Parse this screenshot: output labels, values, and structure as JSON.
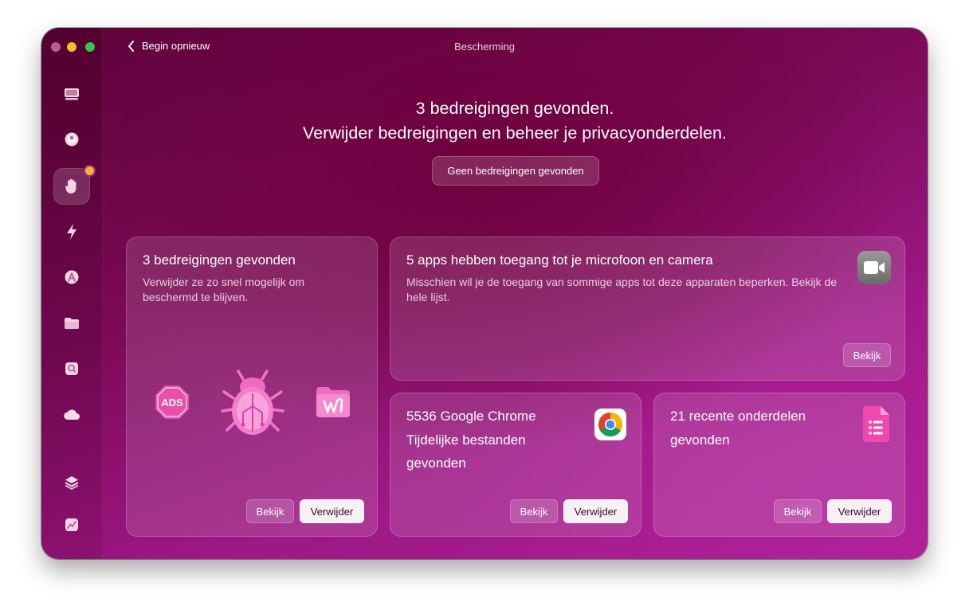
{
  "window": {
    "title": "Bescherming",
    "back_label": "Begin opnieuw"
  },
  "sidebar": {
    "items": [
      {
        "name": "smart-scan",
        "icon": "monitor-icon"
      },
      {
        "name": "cleanup",
        "icon": "disc-icon"
      },
      {
        "name": "protection",
        "icon": "hand-icon",
        "active": true,
        "badge": true
      },
      {
        "name": "performance",
        "icon": "lightning-icon"
      },
      {
        "name": "applications",
        "icon": "apps-icon"
      },
      {
        "name": "my-clutter",
        "icon": "folder-icon"
      },
      {
        "name": "space-lens",
        "icon": "magnifier-icon"
      },
      {
        "name": "cloud-cleanup",
        "icon": "cloud-icon"
      },
      {
        "name": "assistant",
        "icon": "layers-icon"
      },
      {
        "name": "updates",
        "icon": "chart-icon"
      }
    ]
  },
  "main": {
    "headline_line1": "3 bedreigingen gevonden.",
    "headline_line2": "Verwijder bedreigingen en beheer je privacyonderdelen.",
    "status_pill": "Geen bedreigingen gevonden"
  },
  "cards": {
    "threats": {
      "title": "3 bedreigingen gevonden",
      "description": "Verwijder ze zo snel mogelijk om beschermd te blijven.",
      "ads_label": "ADS",
      "view_label": "Bekijk",
      "remove_label": "Verwijder"
    },
    "mic_camera": {
      "title": "5 apps hebben toegang tot je microfoon en camera",
      "description": "Misschien wil je de toegang van sommige apps tot deze apparaten beperken. Bekijk de hele lijst.",
      "view_label": "Bekijk"
    },
    "chrome": {
      "title": "5536 Google Chrome Tijdelijke bestanden gevonden",
      "view_label": "Bekijk",
      "remove_label": "Verwijder"
    },
    "recent": {
      "title": "21 recente onderdelen gevonden",
      "view_label": "Bekijk",
      "remove_label": "Verwijder"
    }
  },
  "colors": {
    "accent_pink": "#e64fb0",
    "badge": "#f2b233",
    "button_light": "#f7f0f4"
  }
}
